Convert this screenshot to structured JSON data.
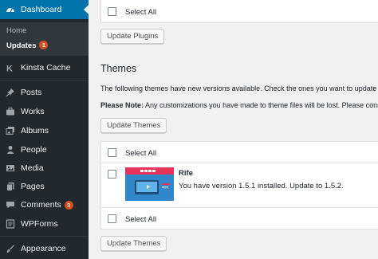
{
  "sidebar": {
    "dashboard": "Dashboard",
    "submenu": {
      "home": "Home",
      "updates": "Updates",
      "updates_count": "1"
    },
    "kinsta": "Kinsta Cache",
    "posts": "Posts",
    "works": "Works",
    "albums": "Albums",
    "people": "People",
    "media": "Media",
    "pages": "Pages",
    "comments": "Comments",
    "comments_count": "3",
    "wpforms": "WPForms",
    "appearance": "Appearance"
  },
  "plugins": {
    "select_all": "Select All",
    "update_button": "Update Plugins"
  },
  "themes": {
    "title": "Themes",
    "intro": "The following themes have new versions available. Check the ones you want to update",
    "note_label": "Please Note:",
    "note_text": " Any customizations you have made to theme files will be lost. Please cons",
    "update_button_top": "Update Themes",
    "select_all_top": "Select All",
    "items": [
      {
        "name": "Rife",
        "desc": "You have version 1.5.1 installed. Update to 1.5.2."
      }
    ],
    "select_all_bottom": "Select All",
    "update_button_bottom": "Update Themes"
  },
  "colors": {
    "sidebar_bg": "#23282d",
    "sidebar_current": "#0073aa",
    "badge": "#d54e21",
    "content_bg": "#f1f1f1"
  }
}
